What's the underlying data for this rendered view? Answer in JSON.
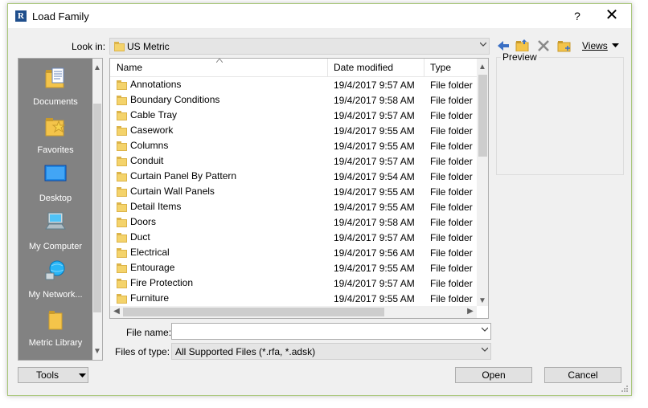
{
  "window": {
    "title": "Load Family",
    "help": "?",
    "close": "✕"
  },
  "look_in": {
    "label": "Look in:",
    "value": "US Metric"
  },
  "toolbar": {
    "views_label": "Views"
  },
  "places": [
    {
      "label": "Documents",
      "icon": "documents-icon"
    },
    {
      "label": "Favorites",
      "icon": "favorites-icon"
    },
    {
      "label": "Desktop",
      "icon": "desktop-icon"
    },
    {
      "label": "My Computer",
      "icon": "computer-icon"
    },
    {
      "label": "My Network...",
      "icon": "network-icon"
    },
    {
      "label": "Metric Library",
      "icon": "folder-icon"
    }
  ],
  "columns": {
    "name": "Name",
    "date": "Date modified",
    "type": "Type"
  },
  "files": [
    {
      "name": "Annotations",
      "date": "19/4/2017 9:57 AM",
      "type": "File folder"
    },
    {
      "name": "Boundary Conditions",
      "date": "19/4/2017 9:58 AM",
      "type": "File folder"
    },
    {
      "name": "Cable Tray",
      "date": "19/4/2017 9:57 AM",
      "type": "File folder"
    },
    {
      "name": "Casework",
      "date": "19/4/2017 9:55 AM",
      "type": "File folder"
    },
    {
      "name": "Columns",
      "date": "19/4/2017 9:55 AM",
      "type": "File folder"
    },
    {
      "name": "Conduit",
      "date": "19/4/2017 9:57 AM",
      "type": "File folder"
    },
    {
      "name": "Curtain Panel By Pattern",
      "date": "19/4/2017 9:54 AM",
      "type": "File folder"
    },
    {
      "name": "Curtain Wall Panels",
      "date": "19/4/2017 9:55 AM",
      "type": "File folder"
    },
    {
      "name": "Detail Items",
      "date": "19/4/2017 9:55 AM",
      "type": "File folder"
    },
    {
      "name": "Doors",
      "date": "19/4/2017 9:58 AM",
      "type": "File folder"
    },
    {
      "name": "Duct",
      "date": "19/4/2017 9:57 AM",
      "type": "File folder"
    },
    {
      "name": "Electrical",
      "date": "19/4/2017 9:56 AM",
      "type": "File folder"
    },
    {
      "name": "Entourage",
      "date": "19/4/2017 9:55 AM",
      "type": "File folder"
    },
    {
      "name": "Fire Protection",
      "date": "19/4/2017 9:57 AM",
      "type": "File folder"
    },
    {
      "name": "Furniture",
      "date": "19/4/2017 9:55 AM",
      "type": "File folder"
    }
  ],
  "preview": {
    "label": "Preview"
  },
  "file_name": {
    "label": "File name:",
    "value": ""
  },
  "file_type": {
    "label": "Files of type:",
    "value": "All Supported Files  (*.rfa, *.adsk)"
  },
  "buttons": {
    "tools": "Tools",
    "open": "Open",
    "cancel": "Cancel"
  }
}
